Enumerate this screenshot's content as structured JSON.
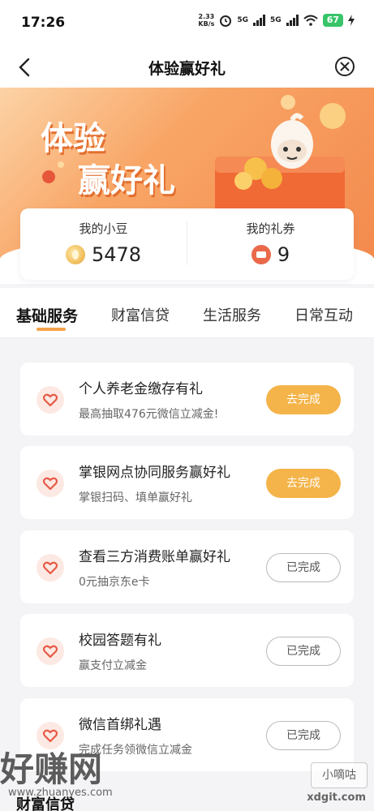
{
  "status_bar": {
    "time": "17:26",
    "net_speed_value": "2.33",
    "net_speed_unit": "KB/s",
    "signal1": "5G",
    "signal2": "5G",
    "battery": "67"
  },
  "nav": {
    "title": "体验赢好礼"
  },
  "banner": {
    "line1": "体验",
    "line2": "赢好礼"
  },
  "wallet": {
    "beans_label": "我的小豆",
    "beans_value": "5478",
    "coupons_label": "我的礼券",
    "coupons_value": "9"
  },
  "tabs": [
    {
      "label": "基础服务"
    },
    {
      "label": "财富信贷"
    },
    {
      "label": "生活服务"
    },
    {
      "label": "日常互动"
    }
  ],
  "tasks": [
    {
      "title": "个人养老金缴存有礼",
      "subtitle": "最高抽取476元微信立减金!",
      "button": "去完成",
      "status": "todo"
    },
    {
      "title": "掌银网点协同服务赢好礼",
      "subtitle": "掌银扫码、填单赢好礼",
      "button": "去完成",
      "status": "todo"
    },
    {
      "title": "查看三方消费账单赢好礼",
      "subtitle": "0元抽京东e卡",
      "button": "已完成",
      "status": "done"
    },
    {
      "title": "校园答题有礼",
      "subtitle": "赢支付立减金",
      "button": "已完成",
      "status": "done"
    },
    {
      "title": "微信首绑礼遇",
      "subtitle": "完成任务领微信立减金",
      "button": "已完成",
      "status": "done"
    }
  ],
  "section_bottom": {
    "title": "财富信贷"
  },
  "watermarks": {
    "left_text": "好赚网",
    "left_url": "www.zhuanyes.com",
    "right_text": "小嘀咕",
    "right_url": "xdgit.com"
  },
  "colors": {
    "accent_orange": "#f4b449",
    "banner_orange": "#f38a4d",
    "tab_underline": "#f3a34a"
  }
}
